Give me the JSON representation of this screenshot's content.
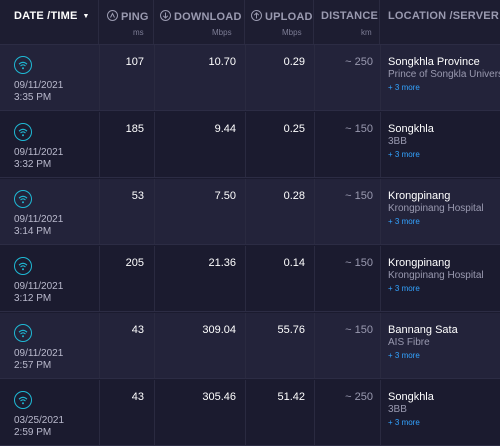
{
  "header": {
    "date_time": "DATE /TIME",
    "ping": "PING",
    "ping_unit": "ms",
    "download": "DOWNLOAD",
    "download_unit": "Mbps",
    "upload": "UPLOAD",
    "upload_unit": "Mbps",
    "distance": "DISTANCE",
    "distance_unit": "km",
    "location": "LOCATION /SERVER"
  },
  "rows": [
    {
      "date": "09/11/2021",
      "time": "3:35 PM",
      "ping": "107",
      "download": "10.70",
      "upload": "0.29",
      "distance": "~ 250",
      "location": "Songkhla Province",
      "server": "Prince of Songkla University",
      "more": "+ 3 more"
    },
    {
      "date": "09/11/2021",
      "time": "3:32 PM",
      "ping": "185",
      "download": "9.44",
      "upload": "0.25",
      "distance": "~ 150",
      "location": "Songkhla",
      "server": "3BB",
      "more": "+ 3 more"
    },
    {
      "date": "09/11/2021",
      "time": "3:14 PM",
      "ping": "53",
      "download": "7.50",
      "upload": "0.28",
      "distance": "~ 150",
      "location": "Krongpinang",
      "server": "Krongpinang Hospital",
      "more": "+ 3 more"
    },
    {
      "date": "09/11/2021",
      "time": "3:12 PM",
      "ping": "205",
      "download": "21.36",
      "upload": "0.14",
      "distance": "~ 150",
      "location": "Krongpinang",
      "server": "Krongpinang Hospital",
      "more": "+ 3 more"
    },
    {
      "date": "09/11/2021",
      "time": "2:57 PM",
      "ping": "43",
      "download": "309.04",
      "upload": "55.76",
      "distance": "~ 150",
      "location": "Bannang Sata",
      "server": "AIS Fibre",
      "more": "+ 3 more"
    },
    {
      "date": "03/25/2021",
      "time": "2:59 PM",
      "ping": "43",
      "download": "305.46",
      "upload": "51.42",
      "distance": "~ 250",
      "location": "Songkhla",
      "server": "3BB",
      "more": "+ 3 more"
    }
  ],
  "colors": {
    "background": "#1b1b2f",
    "accent": "#1fb9d5",
    "link": "#33a3ff"
  },
  "icons": {
    "connection": "wifi-icon",
    "ping": "ping-icon",
    "download": "download-icon",
    "upload": "upload-icon",
    "sort": "sort-down-icon"
  }
}
